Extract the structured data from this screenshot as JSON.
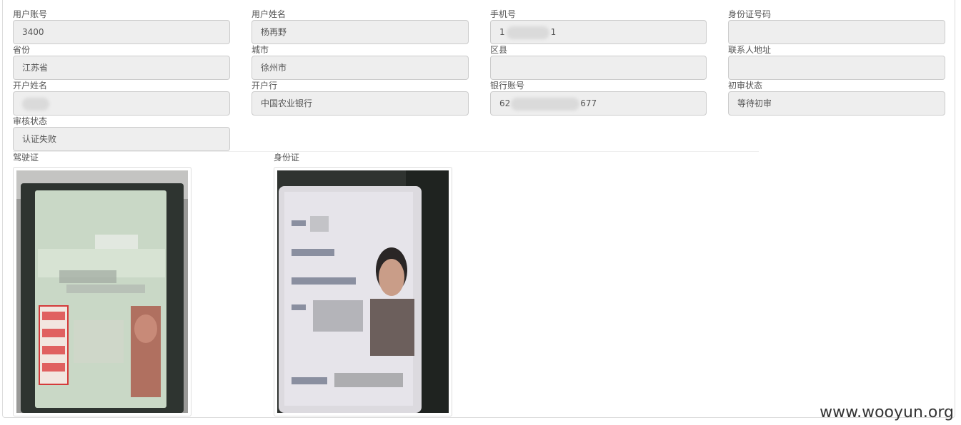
{
  "fields": {
    "user_account": {
      "label": "用户账号",
      "value": "3400"
    },
    "user_name": {
      "label": "用户姓名",
      "value": "杨再野"
    },
    "phone": {
      "label": "手机号",
      "prefix": "1",
      "suffix": "1"
    },
    "id_number": {
      "label": "身份证号码",
      "value": ""
    },
    "province": {
      "label": "省份",
      "value": "江苏省"
    },
    "city": {
      "label": "城市",
      "value": "徐州市"
    },
    "district": {
      "label": "区县",
      "value": ""
    },
    "contact_address": {
      "label": "联系人地址",
      "value": ""
    },
    "account_holder": {
      "label": "开户姓名",
      "value": ""
    },
    "bank": {
      "label": "开户行",
      "value": "中国农业银行"
    },
    "bank_account": {
      "label": "银行账号",
      "prefix": "62",
      "suffix": "677"
    },
    "first_review_status": {
      "label": "初审状态",
      "value": "等待初审"
    },
    "review_status": {
      "label": "审核状态",
      "value": "认证失败"
    }
  },
  "documents": {
    "driver_license": {
      "label": "驾驶证"
    },
    "id_card": {
      "label": "身份证"
    }
  },
  "watermark": "www.wooyun.org",
  "colors": {
    "field_bg": "#eeeeee",
    "field_border": "#cccccc",
    "text": "#555555"
  }
}
